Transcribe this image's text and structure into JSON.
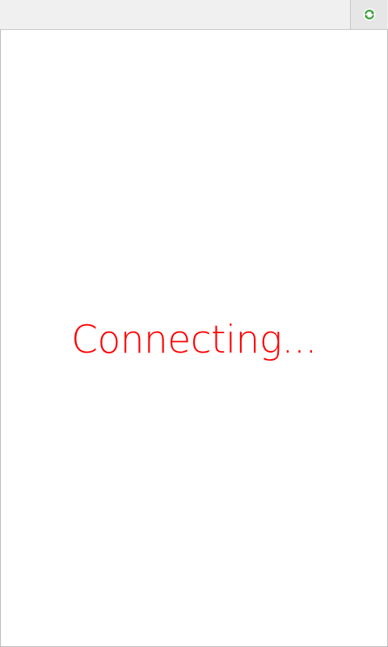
{
  "toolbar": {
    "refresh_icon": "refresh-icon",
    "refresh_icon_color": "#3ca03c"
  },
  "main": {
    "status_text": "Connecting...",
    "status_color": "#ff0000"
  }
}
